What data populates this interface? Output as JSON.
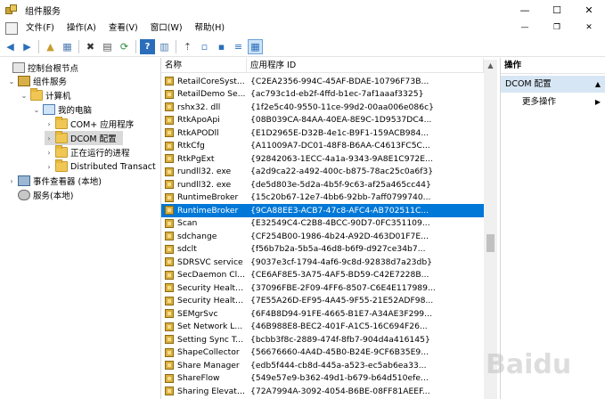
{
  "window": {
    "title": "组件服务",
    "controls": {
      "minimize": "—",
      "maximize": "☐",
      "close": "✕"
    }
  },
  "menu": {
    "items": [
      {
        "label": "文件(F)"
      },
      {
        "label": "操作(A)"
      },
      {
        "label": "查看(V)"
      },
      {
        "label": "窗口(W)"
      },
      {
        "label": "帮助(H)"
      }
    ],
    "doc_controls": {
      "minimize": "—",
      "restore": "❐",
      "close": "✕"
    }
  },
  "toolbar": {
    "buttons": [
      {
        "icon": "back-icon",
        "glyph": "◀"
      },
      {
        "icon": "forward-icon",
        "glyph": "▶"
      },
      {
        "icon": "up-folder-icon",
        "glyph": "▲"
      },
      {
        "icon": "show-tree-icon",
        "glyph": "▦"
      },
      {
        "icon": "delete-icon",
        "glyph": "✖"
      },
      {
        "icon": "properties-icon",
        "glyph": "▤"
      },
      {
        "icon": "refresh-icon",
        "glyph": "⟳"
      },
      {
        "icon": "help-icon",
        "glyph": "?"
      },
      {
        "icon": "show-action-pane-icon",
        "glyph": "▥"
      },
      {
        "icon": "sync-icon",
        "glyph": "⇡"
      },
      {
        "icon": "large-icons-icon",
        "glyph": "▫"
      },
      {
        "icon": "small-icons-icon",
        "glyph": "▪"
      },
      {
        "icon": "list-view-icon",
        "glyph": "≡"
      },
      {
        "icon": "detail-view-icon",
        "glyph": "▦"
      }
    ]
  },
  "tree": {
    "items": [
      {
        "label": "控制台根节点",
        "expander": "",
        "icon": "console"
      },
      {
        "label": "组件服务",
        "expander": "⌄",
        "icon": "comp"
      },
      {
        "label": "计算机",
        "expander": "⌄",
        "icon": "folder"
      },
      {
        "label": "我的电脑",
        "expander": "⌄",
        "icon": "pc"
      },
      {
        "label": "COM+ 应用程序",
        "expander": "›",
        "icon": "folder"
      },
      {
        "label": "DCOM 配置",
        "expander": "›",
        "icon": "folder"
      },
      {
        "label": "正在运行的进程",
        "expander": "›",
        "icon": "folder"
      },
      {
        "label": "Distributed Transact",
        "expander": "›",
        "icon": "folder"
      },
      {
        "label": "事件查看器 (本地)",
        "expander": "›",
        "icon": "ev"
      },
      {
        "label": "服务(本地)",
        "expander": "",
        "icon": "svc"
      }
    ]
  },
  "list": {
    "columns": [
      "名称",
      "应用程序 ID"
    ],
    "selected_index": 11,
    "rows": [
      {
        "name": "RetailCoreSyst...",
        "id": "{C2EA2356-994C-45AF-BDAE-10796F73B..."
      },
      {
        "name": "RetailDemo Se...",
        "id": "{ac793c1d-eb2f-4ffd-b1ec-7af1aaaf3325}"
      },
      {
        "name": "rshx32. dll",
        "id": "{1f2e5c40-9550-11ce-99d2-00aa006e086c}"
      },
      {
        "name": "RtkApoApi",
        "id": "{08B039CA-84AA-40EA-8E9C-1D9537DC4..."
      },
      {
        "name": "RtkAPODll",
        "id": "{E1D2965E-D32B-4e1c-B9F1-159ACB984..."
      },
      {
        "name": "RtkCfg",
        "id": "{A11009A7-DC01-48F8-B6AA-C4613FC5C..."
      },
      {
        "name": "RtkPgExt",
        "id": "{92842063-1ECC-4a1a-9343-9A8E1C972E..."
      },
      {
        "name": "rundll32. exe",
        "id": "{a2d9ca22-a492-400c-b875-78ac25c0a6f3}"
      },
      {
        "name": "rundll32. exe",
        "id": "{de5d803e-5d2a-4b5f-9c63-af25a465cc44}"
      },
      {
        "name": "RuntimeBroker",
        "id": "{15c20b67-12e7-4bb6-92bb-7aff0799740..."
      },
      {
        "name": "RuntimeBroker",
        "id": "{9CA88EE3-ACB7-47c8-AFC4-AB702511C..."
      },
      {
        "name": "Scan",
        "id": "{E32549C4-C2B8-4BCC-90D7-0FC351109..."
      },
      {
        "name": "sdchange",
        "id": "{CF254B00-1986-4b24-A92D-463D01F7E..."
      },
      {
        "name": "sdclt",
        "id": "{f56b7b2a-5b5a-46d8-b6f9-d927ce34b7..."
      },
      {
        "name": "SDRSVC service",
        "id": "{9037e3cf-1794-4af6-9c8d-92838d7a23db}"
      },
      {
        "name": "SecDaemon Cl...",
        "id": "{CE6AF8E5-3A75-4AF5-BD59-C42E7228B..."
      },
      {
        "name": "Security Health...",
        "id": "{37096FBE-2F09-4FF6-8507-C6E4E117989..."
      },
      {
        "name": "Security Health...",
        "id": "{7E55A26D-EF95-4A45-9F55-21E52ADF98..."
      },
      {
        "name": "SEMgrSvc",
        "id": "{6F4B8D94-91FE-4665-B1E7-A34AE3F299..."
      },
      {
        "name": "Set Network L...",
        "id": "{46B988E8-BEC2-401F-A1C5-16C694F26..."
      },
      {
        "name": "Setting Sync Ta...",
        "id": "{bcbb3f8c-2889-474f-8fb7-904d4a416145}"
      },
      {
        "name": "ShapeCollector",
        "id": "{56676660-4A4D-45B0-B24E-9CF6B35E9..."
      },
      {
        "name": "Share Manager",
        "id": "{edb5f444-cb8d-445a-a523-ec5ab6ea33..."
      },
      {
        "name": "ShareFlow",
        "id": "{549e57e9-b362-49d1-b679-b64d510efe..."
      },
      {
        "name": "Sharing Elevate...",
        "id": "{72A7994A-3092-4054-B6BE-08FF81AEEF..."
      }
    ]
  },
  "actions": {
    "header": "操作",
    "section": "DCOM 配置",
    "item": "更多操作",
    "arrow_section": "▲",
    "arrow_item": "▶"
  },
  "watermark": "Baidu"
}
